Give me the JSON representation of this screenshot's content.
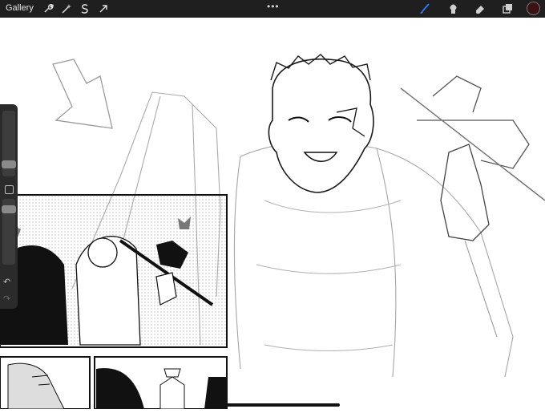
{
  "toolbar": {
    "gallery_label": "Gallery",
    "more_glyph": "•••",
    "left_tools": [
      "wrench-icon",
      "magic-wand-icon",
      "selection-s-icon",
      "move-arrow-icon"
    ],
    "right_tools": [
      "brush-icon",
      "smudge-icon",
      "eraser-icon",
      "layers-icon"
    ],
    "active_color": "#3a1212",
    "active_tool_color": "#2f7cf6"
  },
  "sidebar": {
    "size_slider_level": 0.35,
    "opacity_slider_level": 0.2,
    "undo_glyph": "↶",
    "redo_glyph": "↷"
  }
}
